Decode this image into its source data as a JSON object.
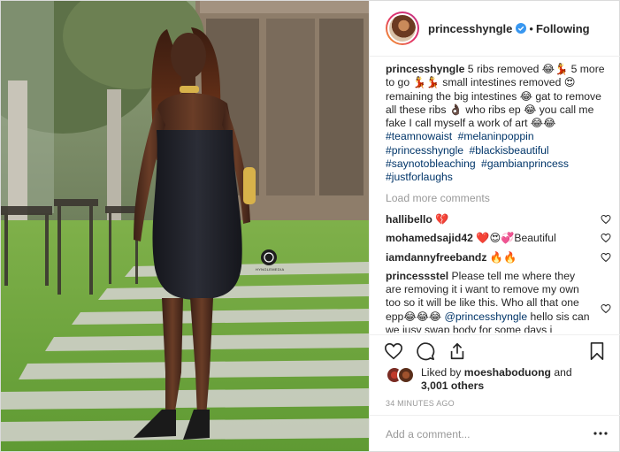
{
  "header": {
    "username": "princesshyngle",
    "separator": "•",
    "follow_state": "Following"
  },
  "caption": {
    "username": "princesshyngle",
    "text": " 5 ribs removed 😂💃 5 more to go 💃💃 small intestines removed 😍 remaining the big intestines 😂 gat to remove all these ribs 👌🏿 who ribs ep 😂 you call me fake I call myself a work of art 😂😂",
    "hashtags": [
      "#teamnowaist",
      "#melaninpoppin",
      "#princesshyngle",
      "#blackisbeautiful",
      "#saynotobleaching",
      "#gambianprincess",
      "#justforlaughs"
    ]
  },
  "load_more": "Load more comments",
  "comments": [
    {
      "user": "hallibello",
      "text": " 💔"
    },
    {
      "user": "mohamedsajid42",
      "text": " ❤️😍💞Beautiful"
    },
    {
      "user": "iamdannyfreebandz",
      "text": " 🔥🔥"
    },
    {
      "user": "princessstel",
      "text": " Please tell me where they are removing it i want to remove my own too so it will be like this. Who all that one epp😂😂😂 ",
      "mention": "@princesshyngle",
      "text_after": " hello sis can we jusy swap body for some days i"
    }
  ],
  "likes": {
    "prefix": "Liked by ",
    "user": "moeshaboduong",
    "middle": " and",
    "count": "3,001 others"
  },
  "timestamp": "34 MINUTES AGO",
  "add_comment": {
    "placeholder": "Add a comment..."
  },
  "photo": {
    "watermark_text": "HYNGLEMEDIA"
  },
  "colors": {
    "link": "#003569",
    "muted": "#999999",
    "verified": "#3897f0",
    "text": "#262626"
  },
  "icons": [
    "verified-badge-icon",
    "heart-icon",
    "comment-icon",
    "share-icon",
    "bookmark-icon",
    "more-options-icon"
  ]
}
